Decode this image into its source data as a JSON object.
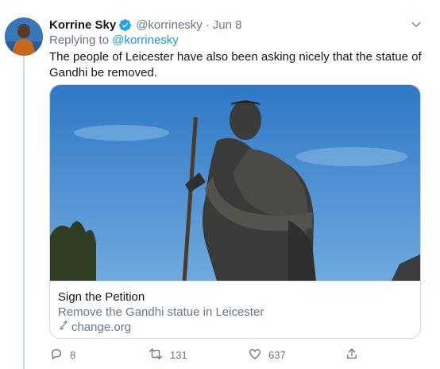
{
  "tweet": {
    "author_name": "Korrine Sky",
    "author_handle": "@korrinesky",
    "separator": "·",
    "date": "Jun 8",
    "replying_prefix": "Replying to",
    "replying_to": "@korrinesky",
    "text": "The people of Leicester have also been asking nicely that the statue of Gandhi be removed."
  },
  "card": {
    "title": "Sign the Petition",
    "description": "Remove the Gandhi statue in Leicester",
    "domain": "change.org"
  },
  "actions": {
    "reply_count": "8",
    "retweet_count": "131",
    "like_count": "637"
  },
  "icons": {
    "verified": "verified-badge-icon",
    "caret": "chevron-down-icon",
    "reply": "reply-icon",
    "retweet": "retweet-icon",
    "like": "heart-icon",
    "share": "share-icon",
    "link": "link-icon"
  },
  "colors": {
    "accent": "#1da1f2",
    "link": "#1b95e0",
    "muted": "#657786",
    "text": "#14171a",
    "border": "#ccd6dd"
  }
}
